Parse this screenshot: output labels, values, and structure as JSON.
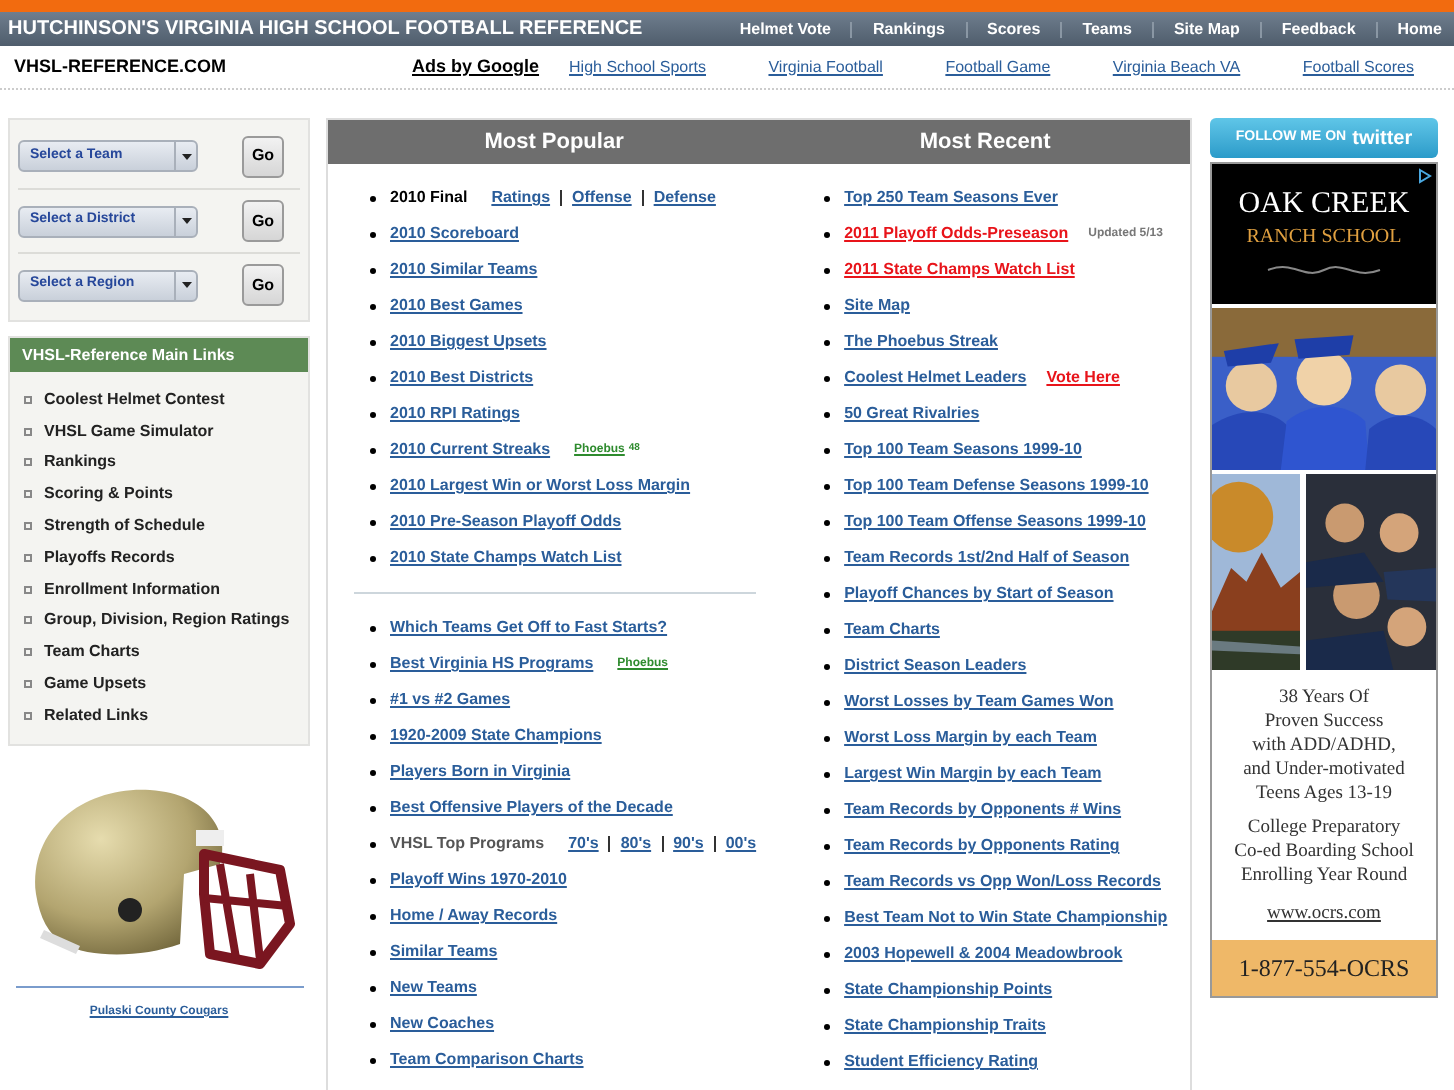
{
  "header": {
    "title": "HUTCHINSON'S VIRGINIA HIGH SCHOOL FOOTBALL REFERENCE",
    "nav": [
      "Helmet Vote",
      "Rankings",
      "Scores",
      "Teams",
      "Site Map",
      "Feedback",
      "Home"
    ]
  },
  "subheader": {
    "site": "VHSL-REFERENCE.COM",
    "ads_label": "Ads by Google",
    "ad_links": [
      "High School Sports",
      "Virginia Football",
      "Football Game",
      "Virginia Beach VA",
      "Football Scores"
    ]
  },
  "selectors": [
    {
      "label": "Select a Team",
      "button": "Go"
    },
    {
      "label": "Select a District",
      "button": "Go"
    },
    {
      "label": "Select a Region",
      "button": "Go"
    }
  ],
  "main_links": {
    "title": "VHSL-Reference Main Links",
    "items": [
      "Coolest Helmet Contest",
      "VHSL Game Simulator",
      "Rankings",
      "Scoring & Points",
      "Strength of Schedule",
      "Playoffs Records",
      "Enrollment Information",
      "Group, Division, Region Ratings",
      "Team Charts",
      "Game Upsets",
      "Related Links"
    ]
  },
  "helmet": {
    "caption": "Pulaski County Cougars"
  },
  "most_popular": {
    "title": "Most Popular",
    "groups": [
      [
        {
          "kind": "plain",
          "label": "2010 Final",
          "links": [
            "Ratings",
            "Offense",
            "Defense"
          ]
        },
        {
          "kind": "link",
          "label": "2010 Scoreboard"
        },
        {
          "kind": "link",
          "label": "2010 Similar Teams"
        },
        {
          "kind": "link",
          "label": "2010 Best Games"
        },
        {
          "kind": "link",
          "label": "2010 Biggest Upsets"
        },
        {
          "kind": "link",
          "label": "2010 Best Districts"
        },
        {
          "kind": "link",
          "label": "2010 RPI Ratings"
        },
        {
          "kind": "link",
          "label": "2010 Current Streaks",
          "tag": "Phoebus",
          "tag_note": "48"
        },
        {
          "kind": "link",
          "label": "2010 Largest Win or Worst Loss Margin"
        },
        {
          "kind": "link",
          "label": "2010 Pre-Season Playoff Odds"
        },
        {
          "kind": "link",
          "label": "2010 State Champs Watch List"
        }
      ],
      [
        {
          "kind": "link",
          "label": "Which Teams Get Off to Fast Starts?"
        },
        {
          "kind": "link",
          "label": "Best Virginia HS Programs",
          "tag": "Phoebus"
        },
        {
          "kind": "link",
          "label": "#1 vs #2 Games"
        },
        {
          "kind": "link",
          "label": "1920-2009 State Champions"
        },
        {
          "kind": "link",
          "label": "Players Born in Virginia"
        },
        {
          "kind": "link",
          "label": "Best Offensive Players of the Decade"
        },
        {
          "kind": "muted",
          "label": "VHSL Top Programs",
          "links": [
            "70's",
            "80's",
            "90's",
            "00's"
          ]
        },
        {
          "kind": "link",
          "label": "Playoff Wins 1970-2010"
        },
        {
          "kind": "link",
          "label": "Home / Away Records"
        },
        {
          "kind": "link",
          "label": "Similar Teams"
        },
        {
          "kind": "link",
          "label": "New Teams"
        },
        {
          "kind": "link",
          "label": "New Coaches"
        },
        {
          "kind": "link",
          "label": "Team Comparison Charts"
        }
      ]
    ]
  },
  "most_recent": {
    "title": "Most Recent",
    "items": [
      {
        "label": "Top 250 Team Seasons Ever",
        "hot": false
      },
      {
        "label": "2011 Playoff Odds-Preseason",
        "hot": true,
        "note": "Updated 5/13"
      },
      {
        "label": "2011 State Champs Watch List",
        "hot": true
      },
      {
        "label": "Site Map",
        "hot": false
      },
      {
        "label": "The Phoebus Streak",
        "hot": false
      },
      {
        "label": "Coolest Helmet Leaders",
        "hot": false,
        "extra": "Vote Here"
      },
      {
        "label": "50 Great Rivalries",
        "hot": false
      },
      {
        "label": "Top 100 Team Seasons 1999-10",
        "hot": false
      },
      {
        "label": "Top 100 Team Defense Seasons 1999-10",
        "hot": false
      },
      {
        "label": "Top 100 Team Offense Seasons 1999-10",
        "hot": false
      },
      {
        "label": "Team Records 1st/2nd Half of Season",
        "hot": false
      },
      {
        "label": "Playoff Chances by Start of Season",
        "hot": false
      },
      {
        "label": "Team Charts",
        "hot": false
      },
      {
        "label": "District Season Leaders",
        "hot": false
      },
      {
        "label": "Worst Losses by Team Games Won",
        "hot": false
      },
      {
        "label": "Worst Loss Margin by each Team",
        "hot": false
      },
      {
        "label": "Largest Win Margin by each Team",
        "hot": false
      },
      {
        "label": "Team Records by Opponents # Wins",
        "hot": false
      },
      {
        "label": "Team Records by Opponents Rating",
        "hot": false
      },
      {
        "label": "Team Records vs Opp Won/Loss Records",
        "hot": false
      },
      {
        "label": "Best Team Not to Win State Championship",
        "hot": false
      },
      {
        "label": "2003 Hopewell & 2004 Meadowbrook",
        "hot": false
      },
      {
        "label": "State Championship Points",
        "hot": false
      },
      {
        "label": "State Championship Traits",
        "hot": false
      },
      {
        "label": "Student Efficiency Rating",
        "hot": false
      }
    ]
  },
  "twitter": {
    "lead": "FOLLOW ME ON",
    "brand": "twitter"
  },
  "ad": {
    "name_top": "OAK CREEK",
    "name_bottom": "RANCH SCHOOL",
    "pitch": [
      "38 Years Of",
      "Proven Success",
      "with ADD/ADHD,",
      "and Under-motivated",
      "Teens Ages 13-19"
    ],
    "details": [
      "College Preparatory",
      "Co-ed Boarding School",
      "Enrolling Year Round"
    ],
    "url": "www.ocrs.com",
    "phone": "1-877-554-OCRS"
  }
}
